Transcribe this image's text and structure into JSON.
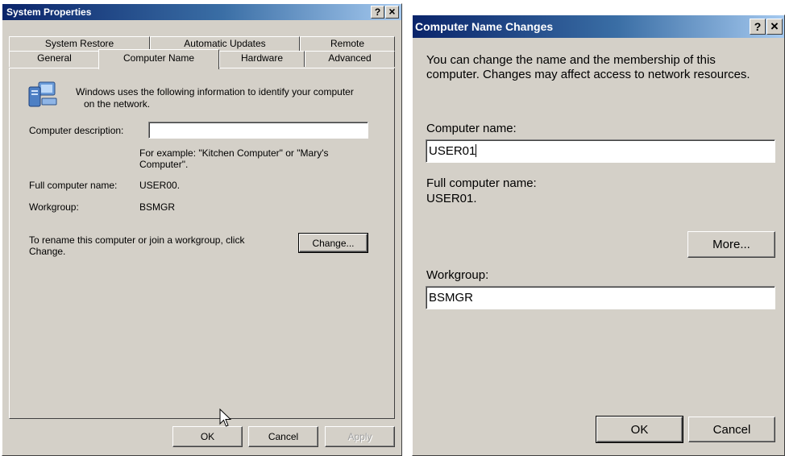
{
  "left": {
    "title": "System Properties",
    "help_btn": "?",
    "close_btn": "×",
    "tabs_top": [
      "System Restore",
      "Automatic Updates",
      "Remote"
    ],
    "tabs_bottom": [
      "General",
      "Computer Name",
      "Hardware",
      "Advanced"
    ],
    "info_text_1": "Windows uses the following information to identify your computer",
    "info_text_2": "on the network.",
    "desc_label": "Computer description:",
    "desc_value": "",
    "example_1": "For example: \"Kitchen Computer\" or \"Mary's",
    "example_2": "Computer\".",
    "full_name_label": "Full computer name:",
    "full_name_value": "USER00.",
    "workgroup_label": "Workgroup:",
    "workgroup_value": "BSMGR",
    "rename_text_1": "To rename this computer or join a workgroup, click",
    "rename_text_2": "Change.",
    "change_btn": "Change...",
    "ok_btn": "OK",
    "cancel_btn": "Cancel",
    "apply_btn": "Apply"
  },
  "right": {
    "title": "Computer Name Changes",
    "help_btn": "?",
    "close_btn": "×",
    "intro_1": "You can change the name and the membership of this",
    "intro_2": "computer. Changes may affect access to network resources.",
    "name_label": "Computer name:",
    "name_value": "USER01",
    "full_label": "Full computer name:",
    "full_value": "USER01.",
    "more_btn": "More...",
    "workgroup_label": "Workgroup:",
    "workgroup_value": "BSMGR",
    "ok_btn": "OK",
    "cancel_btn": "Cancel"
  }
}
